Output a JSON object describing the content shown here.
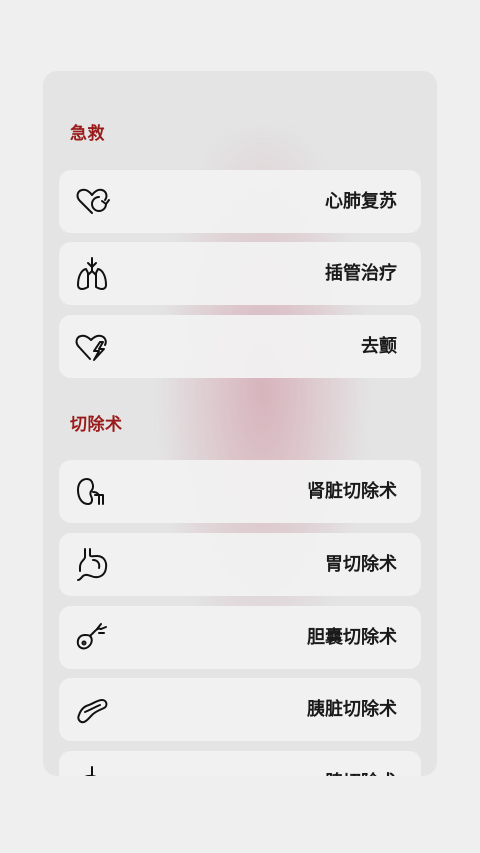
{
  "sections": [
    {
      "title": "急救",
      "items": [
        {
          "label": "心肺复苏",
          "icon": "heart-refresh-icon"
        },
        {
          "label": "插管治疗",
          "icon": "lungs-intubation-icon"
        },
        {
          "label": "去颤",
          "icon": "heart-lightning-icon"
        }
      ]
    },
    {
      "title": "切除术",
      "items": [
        {
          "label": "肾脏切除术",
          "icon": "kidney-icon"
        },
        {
          "label": "胃切除术",
          "icon": "stomach-icon"
        },
        {
          "label": "胆囊切除术",
          "icon": "gallbladder-icon"
        },
        {
          "label": "胰脏切除术",
          "icon": "pancreas-icon"
        },
        {
          "label": "脾切除术",
          "icon": "spleen-icon"
        }
      ]
    }
  ],
  "colors": {
    "section_title": "#9a1b1b",
    "panel_bg": "#e4e4e4",
    "card_bg": "#f2f2f2",
    "accent_glow": "#c8788c"
  }
}
